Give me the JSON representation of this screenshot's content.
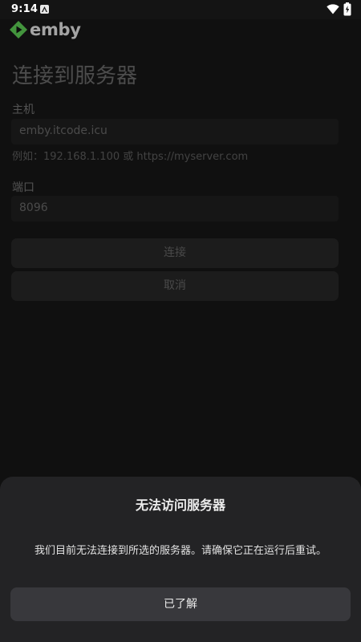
{
  "status_bar": {
    "time": "9:14",
    "notification_icon": "a-badge-icon",
    "wifi_icon": "wifi-icon",
    "battery_icon": "battery-charging-icon"
  },
  "app": {
    "brand": "emby",
    "brand_color": "#52b54b"
  },
  "connect_form": {
    "title": "连接到服务器",
    "host_label": "主机",
    "host_value": "emby.itcode.icu",
    "host_hint": "例如：192.168.1.100 或 https://myserver.com",
    "port_label": "端口",
    "port_value": "8096",
    "connect_label": "连接",
    "cancel_label": "取消"
  },
  "dialog": {
    "title": "无法访问服务器",
    "message": "我们目前无法连接到所选的服务器。请确保它正在运行后重试。",
    "ok_label": "已了解"
  }
}
